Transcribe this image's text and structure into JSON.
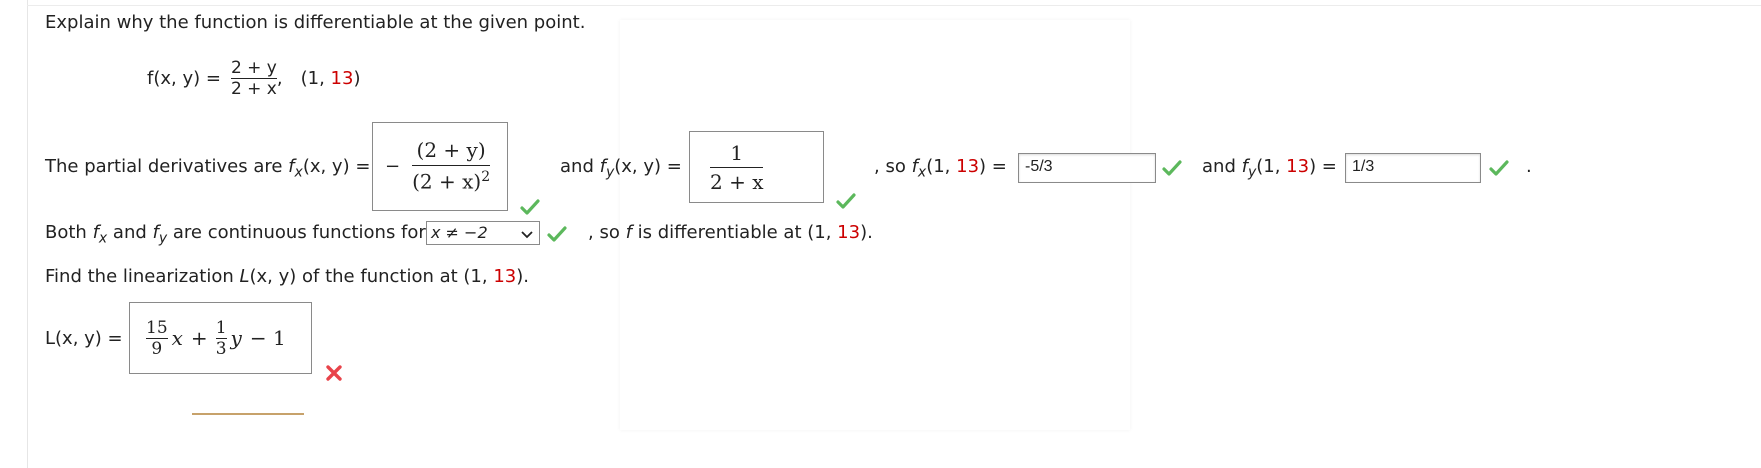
{
  "question": "Explain why the function is differentiable at the given point.",
  "function": {
    "lhs": "f(x, y) =",
    "numerator": "2 + y",
    "denominator": "2 + x",
    "comma": ",",
    "point_open": "(1, ",
    "point_y": "13",
    "point_close": ")"
  },
  "partials": {
    "intro": "The partial derivatives are ",
    "fx_name": "f",
    "fx_sub": "x",
    "fx_args": "(x, y) =",
    "fx_minus": "−",
    "fx_num": "(2 + y)",
    "fx_den": "(2 + x)",
    "fx_den_exp": "2",
    "and1": "and ",
    "fy_name": "f",
    "fy_sub": "y",
    "fy_args": "(x, y) =",
    "fy_num": "1",
    "fy_den": "2 + x",
    "so": ", so ",
    "fx_at_name": "f",
    "fx_at_sub": "x",
    "fx_at_open": "(1, ",
    "fx_at_y": "13",
    "fx_at_close": ") =",
    "fx_value": "-5/3",
    "and2": "and ",
    "fy_at_name": "f",
    "fy_at_sub": "y",
    "fy_at_open": "(1, ",
    "fy_at_y": "13",
    "fy_at_close": ") =",
    "fy_value": "1/3",
    "end": "."
  },
  "continuity": {
    "text1": "Both ",
    "fx_name": "f",
    "fx_sub": "x",
    "and": " and ",
    "fy_name": "f",
    "fy_sub": "y",
    "text2": " are continuous functions for ",
    "select_value": "x ≠ −2",
    "text3": ", so ",
    "f": "f",
    "text4": " is differentiable at (1, ",
    "y": "13",
    "text5": ")."
  },
  "linearization": {
    "prompt_start": "Find the linearization ",
    "L": "L",
    "args": "(x, y)",
    "prompt_mid": " of the function at (1, ",
    "y": "13",
    "prompt_end": ").",
    "lhs": "L(x, y) =",
    "a_num": "15",
    "a_den": "9",
    "x": "x",
    "plus": "+",
    "b_num": "1",
    "b_den": "3",
    "y_var": "y",
    "minus_const": "− 1"
  },
  "colors": {
    "check": "#5cb85c",
    "cross": "#e8434a",
    "red_text": "#cc0000"
  },
  "icons": {
    "correct": "check-icon",
    "incorrect": "cross-icon",
    "dropdown": "chevron-down-icon"
  }
}
